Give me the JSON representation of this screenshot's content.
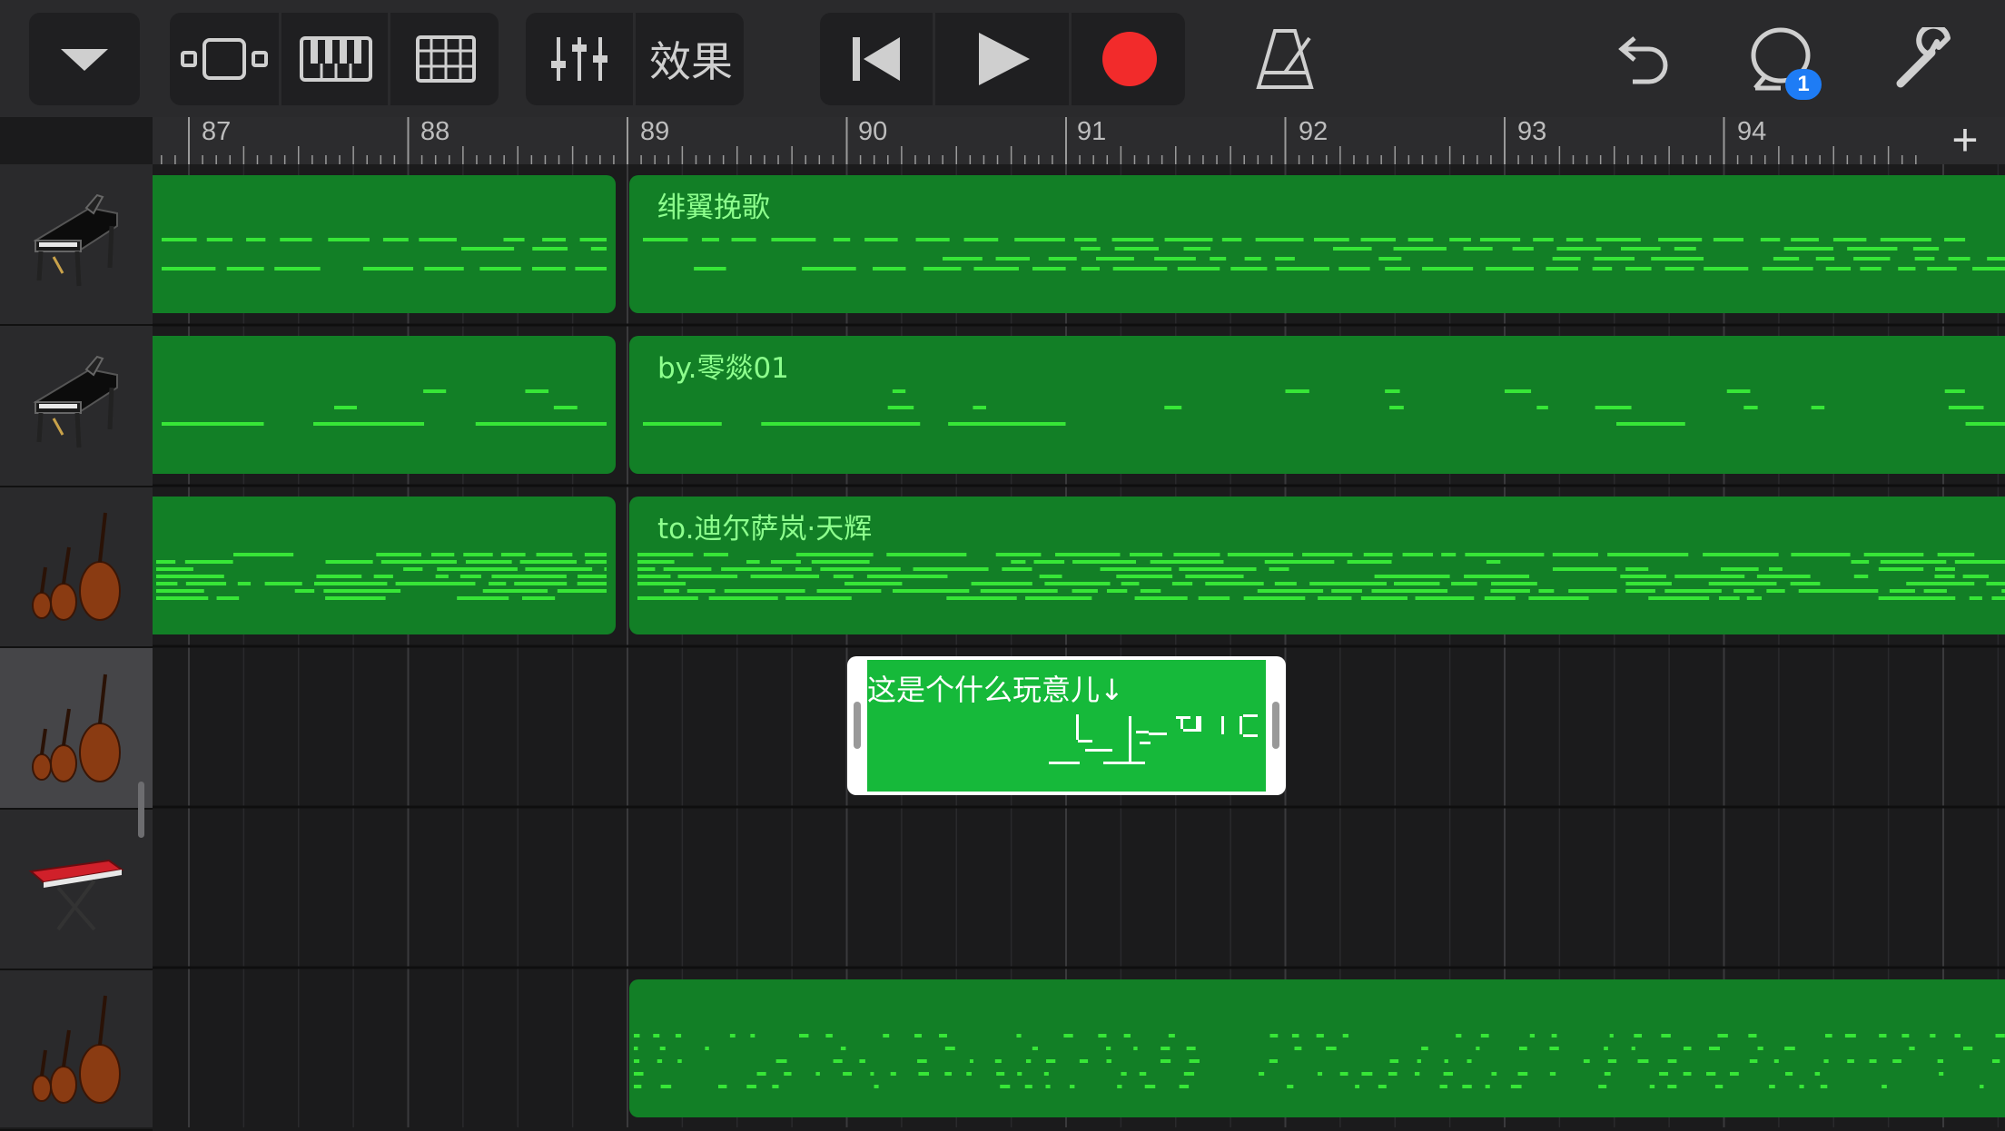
{
  "toolbar": {
    "fx_label": "效果",
    "chat_badge": "1",
    "colors": {
      "record": "#f22b2b",
      "badge": "#1e7cf5",
      "icon": "#cfcfcf"
    }
  },
  "ruler": {
    "bars": [
      "87",
      "88",
      "89",
      "90",
      "91",
      "92",
      "93",
      "94"
    ],
    "add_label": "+"
  },
  "tracks": [
    {
      "instrument": "grand-piano-icon"
    },
    {
      "instrument": "grand-piano-icon"
    },
    {
      "instrument": "strings-icon"
    },
    {
      "instrument": "strings-icon",
      "selected": true
    },
    {
      "instrument": "synth-keyboard-icon"
    },
    {
      "instrument": "strings-icon"
    }
  ],
  "regions": {
    "track1_label": "绯翼挽歌",
    "track2_label": "by.零燚01",
    "track3_label": "to.迪尔萨岚·天辉",
    "selected_label": "这是个什么玩意儿↓"
  },
  "colors": {
    "region_fill": "#127f26",
    "note": "#37e637",
    "selected_fill": "#16b93a"
  }
}
